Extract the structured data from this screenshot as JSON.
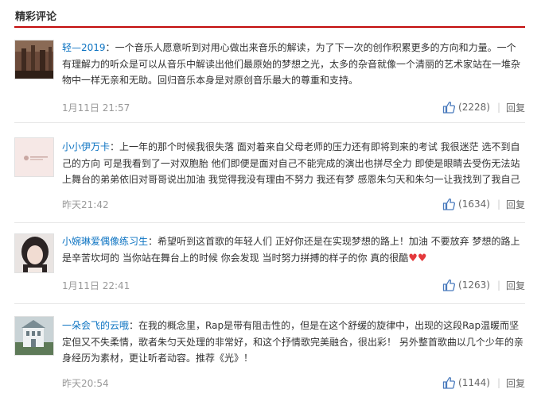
{
  "section": {
    "title": "精彩评论"
  },
  "like_color": "#4a7bbd",
  "author_color": "#0c73c2",
  "comments": [
    {
      "author": "轻—2019",
      "separator": "：",
      "text_lines": [
        "一个音乐人愿意听到对用心做出来音乐的解读，为了下一次的创作积累更多的方向和力量。一个",
        "有理解力的听众是可以从音乐中解读出他们最原始的梦想之光，太多的杂音就像一个清丽的艺术家站在一堆杂",
        "物中一样无亲和无助。回归音乐本身是对原创音乐最大的尊重和支持。"
      ],
      "time": "1月11日 21:57",
      "likes": "(2228)",
      "reply": "回复",
      "avatar_icon": "avatar-photo"
    },
    {
      "author": "小小伊万卡",
      "separator": "：",
      "text_lines": [
        "上一年的那个时候我很失落 面对着来自父母老师的压力还有即将到来的考试 我很迷茫 选不到自",
        "己的方向 可是我看到了一对双胞胎 他们即便是面对自己不能完成的演出也拼尽全力 即使是眼睛去受伤无法站",
        "上舞台的弟弟依旧对哥哥说出加油 我觉得我没有理由不努力 我还有梦 感恩朱匀天和朱匀一让我找到了我自己"
      ],
      "time": "昨天21:42",
      "likes": "(1634)",
      "reply": "回复",
      "avatar_icon": "avatar-logo"
    },
    {
      "author": "小婉琳爱偶像练习生",
      "separator": "：",
      "text_lines": [
        "希望听到这首歌的年轻人们 正好你还是在实现梦想的路上！加油 不要放弃 梦想的路上",
        "是辛苦坎坷的 当你站在舞台上的时候 你会发现 当时努力拼搏的样子的你 真的很酷"
      ],
      "hearts": "♥♥",
      "time": "1月11日 22:41",
      "likes": "(1263)",
      "reply": "回复",
      "avatar_icon": "avatar-girl"
    },
    {
      "author": "一朵会飞的云哦",
      "separator": "：",
      "text_lines": [
        "在我的概念里，Rap是带有阻击性的，但是在这个舒缓的旋律中，出现的这段Rap温暖而坚",
        "定但又不失柔情，歌者朱匀天处理的非常好，和这个抒情歌完美融合，很出彩！ 另外整首歌曲以几个少年的亲",
        "身经历为素材，更让听者动容。推荐《光》！"
      ],
      "time": "昨天20:54",
      "likes": "(1144)",
      "reply": "回复",
      "avatar_icon": "avatar-building"
    }
  ]
}
